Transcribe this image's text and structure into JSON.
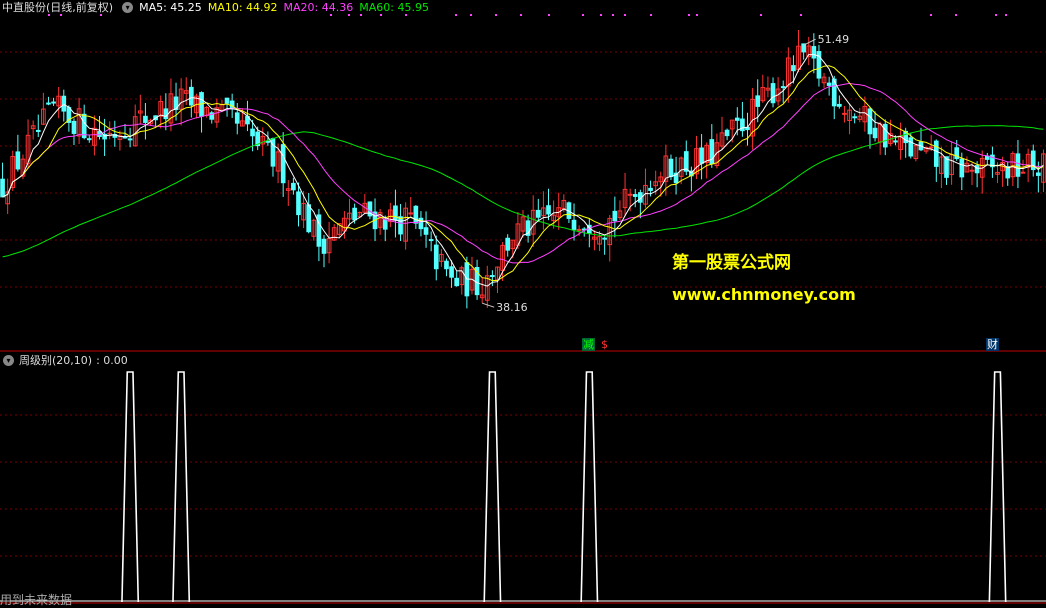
{
  "header": {
    "stock_label": "中直股份(日线,前复权)",
    "ma5_label": "MA5: 45.25",
    "ma10_label": "MA10: 44.92",
    "ma20_label": "MA20: 44.36",
    "ma60_label": "MA60: 45.95",
    "toggle_icon": "▾"
  },
  "indicator": {
    "label": "周级别(20,10)",
    "value": ": 0.00"
  },
  "watermark": {
    "cn": "第一股票公式网",
    "url": "www.chnmoney.com"
  },
  "footer": {
    "text": "用到未来数据"
  },
  "signals": {
    "s1": "减",
    "s2": "$",
    "s3": "财"
  },
  "colors": {
    "up": "#ff3232",
    "down": "#54ffff",
    "ma5": "#ffffff",
    "ma10": "#ffff00",
    "ma20": "#ff40ff",
    "ma60": "#00e600",
    "grid": "#7a0000"
  },
  "chart_data": [
    {
      "type": "candlestick",
      "title": "中直股份(日线,前复权)",
      "ylim": [
        36,
        53
      ],
      "annotations": [
        {
          "text": "51.49",
          "at_index": 157,
          "value": 51.49
        },
        {
          "text": "38.16",
          "at_index": 94,
          "value": 38.16
        }
      ],
      "key_points": [
        {
          "i": 0,
          "close": 44.3
        },
        {
          "i": 10,
          "close": 48.2
        },
        {
          "i": 20,
          "close": 46.8
        },
        {
          "i": 35,
          "close": 48.6
        },
        {
          "i": 45,
          "close": 47.6
        },
        {
          "i": 55,
          "close": 45.1
        },
        {
          "i": 62,
          "close": 41.3
        },
        {
          "i": 70,
          "close": 42.8
        },
        {
          "i": 80,
          "close": 42.4
        },
        {
          "i": 88,
          "close": 39.3
        },
        {
          "i": 94,
          "close": 39.2
        },
        {
          "i": 100,
          "close": 41.7
        },
        {
          "i": 110,
          "close": 42.9
        },
        {
          "i": 118,
          "close": 42.2
        },
        {
          "i": 128,
          "close": 44.9
        },
        {
          "i": 138,
          "close": 45.6
        },
        {
          "i": 148,
          "close": 48.3
        },
        {
          "i": 157,
          "close": 51.0
        },
        {
          "i": 165,
          "close": 48.4
        },
        {
          "i": 175,
          "close": 46.4
        },
        {
          "i": 185,
          "close": 45.2
        },
        {
          "i": 192,
          "close": 45.0
        },
        {
          "i": 203,
          "close": 45.25
        }
      ],
      "series": [
        {
          "name": "MA5",
          "value": 45.25
        },
        {
          "name": "MA10",
          "value": 44.92
        },
        {
          "name": "MA20",
          "value": 44.36
        },
        {
          "name": "MA60",
          "value": 45.95
        }
      ]
    },
    {
      "type": "line",
      "title": "周级别(20,10)",
      "value": 0.0,
      "ylim": [
        0,
        1
      ],
      "spikes": [
        25,
        35,
        96,
        115,
        195
      ]
    }
  ]
}
